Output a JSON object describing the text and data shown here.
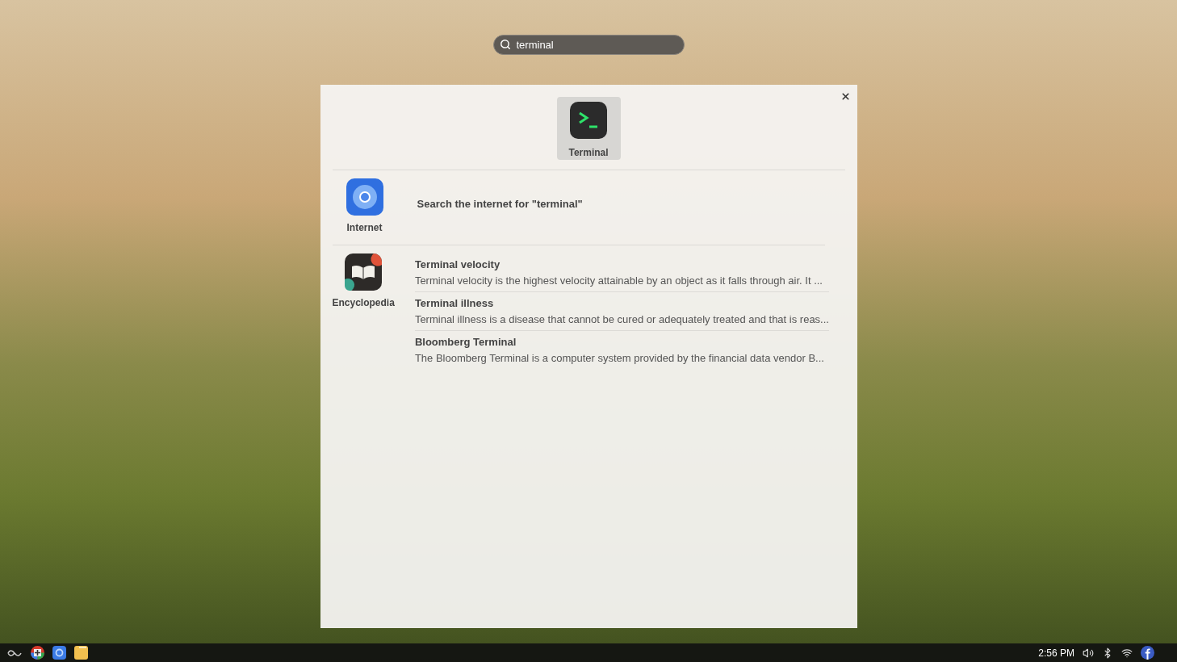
{
  "search": {
    "value": "terminal"
  },
  "top_results": [
    {
      "label": "Terminal",
      "selected": true
    }
  ],
  "sections": [
    {
      "label": "Internet",
      "kind": "web",
      "items": [
        {
          "title": "Search the internet for \"terminal\""
        }
      ]
    },
    {
      "label": "Encyclopedia",
      "kind": "wiki",
      "items": [
        {
          "title": "Terminal velocity",
          "description": "Terminal velocity is the highest velocity attainable by an object as it falls through air. It ..."
        },
        {
          "title": "Terminal illness",
          "description": "Terminal illness is a disease that cannot be cured or adequately treated and that is reas..."
        },
        {
          "title": "Bloomberg Terminal",
          "description": "The Bloomberg Terminal is a computer system provided by the financial data vendor B..."
        }
      ]
    }
  ],
  "taskbar": {
    "clock": "2:56 PM"
  }
}
